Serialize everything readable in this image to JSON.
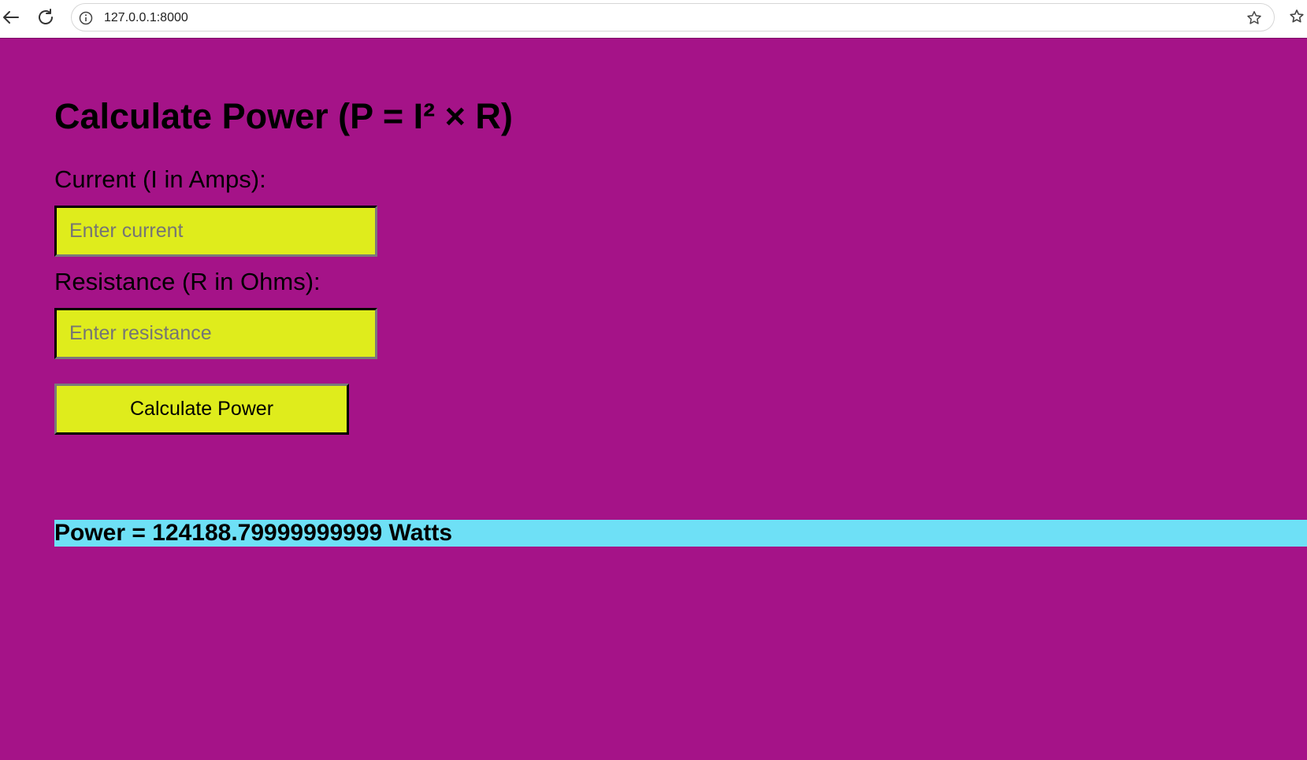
{
  "browser": {
    "url": "127.0.0.1:8000",
    "icons": {
      "back": "arrow-left-icon",
      "reload": "reload-icon",
      "site_info": "info-icon",
      "bookmark": "star-icon",
      "extension": "star-list-icon"
    }
  },
  "page": {
    "background_color": "#a51388",
    "title": "Calculate Power (P = I² × R)",
    "current": {
      "label": "Current (I in Amps):",
      "placeholder": "Enter current",
      "value": ""
    },
    "resistance": {
      "label": "Resistance (R in Ohms):",
      "placeholder": "Enter resistance",
      "value": ""
    },
    "button_label": "Calculate Power",
    "input_color": "#dfec1c",
    "result": {
      "text": "Power = 124188.79999999999 Watts",
      "background_color": "#6ee0f6"
    }
  }
}
